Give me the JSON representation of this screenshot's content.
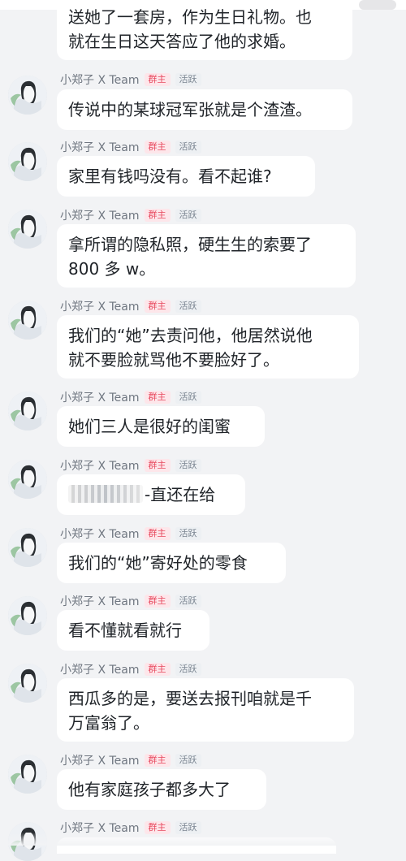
{
  "chat": {
    "top_message": {
      "text": "送她了一套房，作为生日礼物。也\n就在生日这天答应了他的求婚。"
    },
    "messages": [
      {
        "sender_name": "小郑子 X Team",
        "badge_owner": "群主",
        "badge_active": "活跃",
        "text": "传说中的某球冠军张就是个渣渣。"
      },
      {
        "sender_name": "小郑子 X Team",
        "badge_owner": "群主",
        "badge_active": "活跃",
        "text": "家里有钱吗没有。看不起谁?"
      },
      {
        "sender_name": "小郑子 X Team",
        "badge_owner": "群主",
        "badge_active": "活跃",
        "text": "拿所谓的隐私照，硬生生的索要了\n800 多 w。"
      },
      {
        "sender_name": "小郑子 X Team",
        "badge_owner": "群主",
        "badge_active": "活跃",
        "text": "我们的“她”去责问他，他居然说他\n就不要脸就骂他不要脸好了。"
      },
      {
        "sender_name": "小郑子 X Team",
        "badge_owner": "群主",
        "badge_active": "活跃",
        "text": "她们三人是很好的闺蜜"
      },
      {
        "sender_name": "小郑子 X Team",
        "badge_owner": "群主",
        "badge_active": "活跃",
        "text": "-直还在给",
        "has_redaction": true
      },
      {
        "sender_name": "小郑子 X Team",
        "badge_owner": "群主",
        "badge_active": "活跃",
        "text": "我们的“她”寄好处的零食"
      },
      {
        "sender_name": "小郑子 X Team",
        "badge_owner": "群主",
        "badge_active": "活跃",
        "text": "看不懂就看就行"
      },
      {
        "sender_name": "小郑子 X Team",
        "badge_owner": "群主",
        "badge_active": "活跃",
        "text": "西瓜多的是，要送去报刊咱就是千\n万富翁了。"
      },
      {
        "sender_name": "小郑子 X Team",
        "badge_owner": "群主",
        "badge_active": "活跃",
        "text": "他有家庭孩子都多大了"
      },
      {
        "sender_name": "小郑子 X Team",
        "badge_owner": "群主",
        "badge_active": "活跃",
        "text": ""
      }
    ]
  },
  "colors": {
    "background": "#f2f3f5",
    "bubble": "#ffffff",
    "owner_badge_text": "#e84a5f",
    "owner_badge_bg": "#fde6ea",
    "active_badge_text": "#7b8591",
    "active_badge_bg": "#edf0f3"
  }
}
